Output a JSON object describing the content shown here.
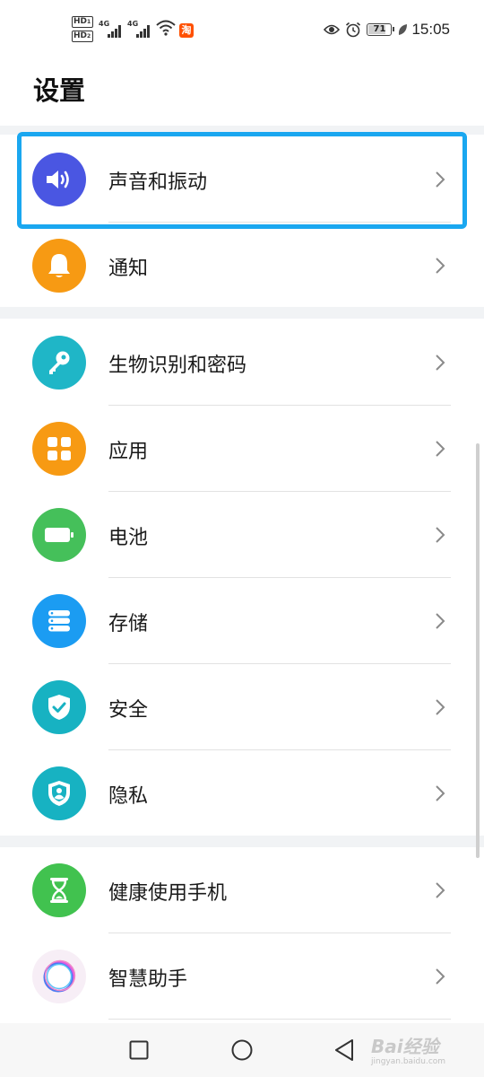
{
  "status_bar": {
    "hd1": "HD",
    "hd1_sub": "1",
    "hd2": "HD",
    "hd2_sub": "2",
    "sig1_label": "4G",
    "sig2_label": "4G",
    "taobao_icon_text": "淘",
    "battery_level": "71",
    "time": "15:05"
  },
  "header": {
    "title": "设置"
  },
  "groups": [
    {
      "items": [
        {
          "label": "声音和振动",
          "icon": "speaker-icon",
          "color": "#4a56e2"
        },
        {
          "label": "通知",
          "icon": "bell-icon",
          "color": "#f79a13"
        }
      ]
    },
    {
      "items": [
        {
          "label": "生物识别和密码",
          "icon": "key-icon",
          "color": "#1fb6c7"
        },
        {
          "label": "应用",
          "icon": "apps-grid-icon",
          "color": "#f79a13"
        },
        {
          "label": "电池",
          "icon": "battery-icon",
          "color": "#45c05a"
        },
        {
          "label": "存储",
          "icon": "storage-icon",
          "color": "#1b9cf2"
        },
        {
          "label": "安全",
          "icon": "shield-check-icon",
          "color": "#17b2c2"
        },
        {
          "label": "隐私",
          "icon": "privacy-shield-icon",
          "color": "#17b2c2"
        }
      ]
    },
    {
      "items": [
        {
          "label": "健康使用手机",
          "icon": "hourglass-icon",
          "color": "#41c24f"
        },
        {
          "label": "智慧助手",
          "icon": "assistant-ring-icon",
          "color": "#ffffff"
        }
      ]
    }
  ],
  "highlight_color": "#1aa7f0",
  "watermark": {
    "main": "Bai经验",
    "sub": "jingyan.baidu.com"
  }
}
